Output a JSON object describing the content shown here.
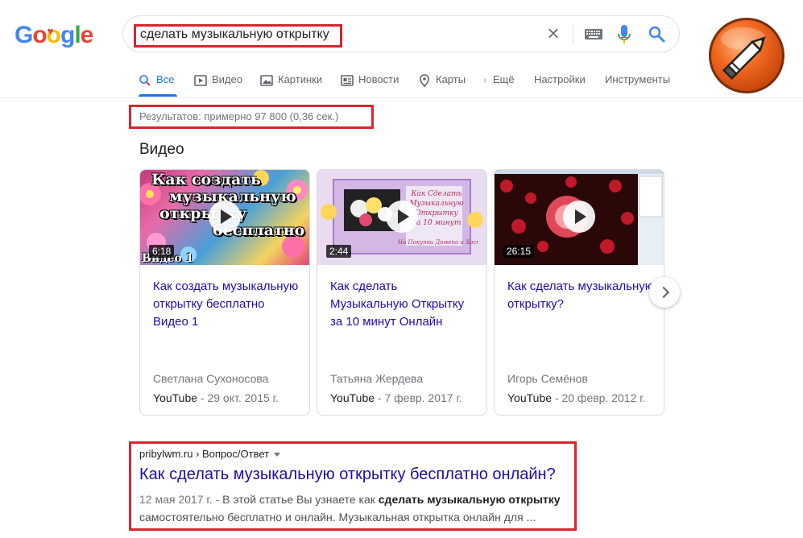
{
  "logo": {
    "text": "Google"
  },
  "search": {
    "query": "сделать музыкальную открытку",
    "clear_label": "×"
  },
  "tabs": [
    {
      "label": "Все",
      "icon": "search-icon"
    },
    {
      "label": "Видео",
      "icon": "video-icon"
    },
    {
      "label": "Картинки",
      "icon": "image-icon"
    },
    {
      "label": "Новости",
      "icon": "news-icon"
    },
    {
      "label": "Карты",
      "icon": "map-pin-icon"
    },
    {
      "label": "Ещё",
      "icon": "more-vert-icon"
    },
    {
      "label": "Настройки"
    },
    {
      "label": "Инструменты"
    }
  ],
  "stats": "Результатов: примерно 97 800 (0,36 сек.)",
  "video_section": {
    "heading": "Видео",
    "cards": [
      {
        "duration": "6:18",
        "title": "Как создать музыкальную открытку бесплатно Видео 1",
        "author": "Светлана Сухоносова",
        "platform": "YouTube",
        "date": " - 29 окт. 2015 г.",
        "thumb_text": [
          "Как создать",
          "музыкальную",
          "открытку",
          "бесплатно",
          "Видео 1"
        ]
      },
      {
        "duration": "2:44",
        "title": "Как сделать Музыкальную Открытку за 10 минут Онлайн",
        "author": "Татьяна Жердева",
        "platform": "YouTube",
        "date": " - 7 февр. 2017 г.",
        "thumb_text": [
          "Как Сделать",
          "Музыкальную",
          "Открытку",
          "За 10 минут",
          "На Покупки Домена и Хостинга!!!"
        ]
      },
      {
        "duration": "26:15",
        "title": "Как сделать музыкальную открытку?",
        "author": "Игорь Семёнов",
        "platform": "YouTube",
        "date": " - 20 февр. 2012 г."
      }
    ]
  },
  "result": {
    "breadcrumb": "pribylwm.ru › Вопрос/Ответ",
    "title": "Как сделать музыкальную открытку бесплатно онлайн?",
    "date": "12 мая 2017 г. - ",
    "snippet_pre": "В этой статье Вы узнаете как ",
    "snippet_bold": "сделать музыкальную открытку",
    "snippet_post": " самостоятельно бесплатно и онлайн. Музыкальная открытка онлайн для ..."
  },
  "colors": {
    "highlight": "#d7262e",
    "link": "#1a0dab",
    "accent": "#1a73e8",
    "badge_orange": "#f26a21"
  }
}
